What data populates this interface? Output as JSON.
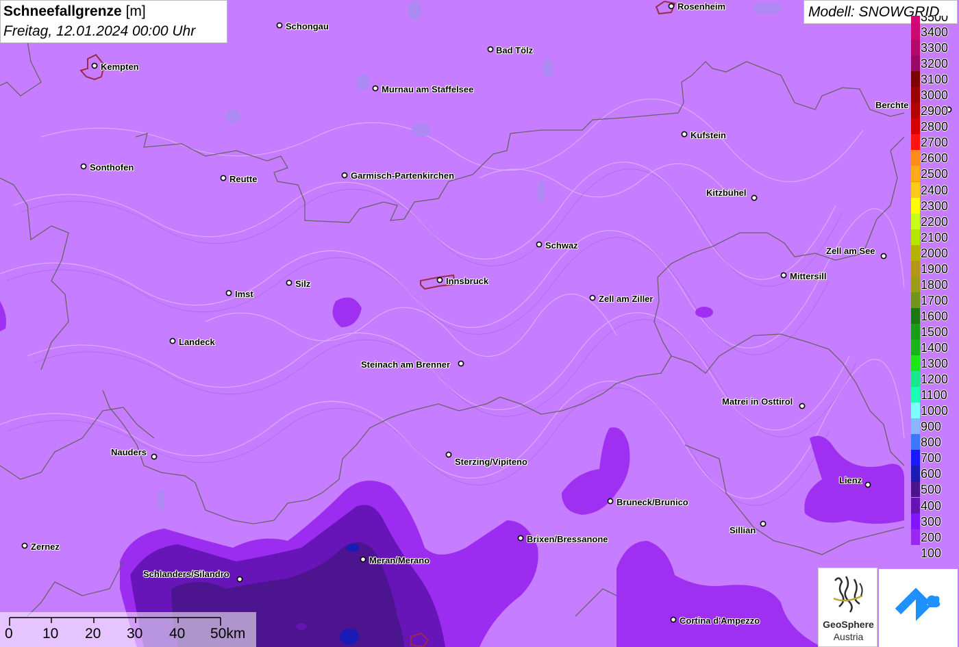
{
  "header": {
    "title": "Schneefallgrenze",
    "unit": "[m]",
    "datetime": "Freitag, 12.01.2024 00:00 Uhr",
    "model": "Modell: SNOWGRID"
  },
  "legend": {
    "partial_top": "3500",
    "items": [
      {
        "label": "3400",
        "color": "#cc0a6e"
      },
      {
        "label": "3300",
        "color": "#b30a6a"
      },
      {
        "label": "3200",
        "color": "#990a66"
      },
      {
        "label": "3100",
        "color": "#7f0000"
      },
      {
        "label": "3000",
        "color": "#990000"
      },
      {
        "label": "2900",
        "color": "#b30000"
      },
      {
        "label": "2800",
        "color": "#d40000"
      },
      {
        "label": "2700",
        "color": "#ff1414"
      },
      {
        "label": "2600",
        "color": "#ff8c1a"
      },
      {
        "label": "2500",
        "color": "#ffaa1a"
      },
      {
        "label": "2400",
        "color": "#ffc81a"
      },
      {
        "label": "2300",
        "color": "#ffff00"
      },
      {
        "label": "2200",
        "color": "#c8ff1a"
      },
      {
        "label": "2100",
        "color": "#b4e600"
      },
      {
        "label": "2000",
        "color": "#b4b400"
      },
      {
        "label": "1900",
        "color": "#b4961a"
      },
      {
        "label": "1800",
        "color": "#9b9b1a"
      },
      {
        "label": "1700",
        "color": "#6e961a"
      },
      {
        "label": "1600",
        "color": "#1a7814"
      },
      {
        "label": "1500",
        "color": "#1a9b1a"
      },
      {
        "label": "1400",
        "color": "#1ab41a"
      },
      {
        "label": "1300",
        "color": "#1ae61a"
      },
      {
        "label": "1200",
        "color": "#1ae68c"
      },
      {
        "label": "1100",
        "color": "#1affb4"
      },
      {
        "label": "1000",
        "color": "#7fffff"
      },
      {
        "label": "900",
        "color": "#8cb4ff"
      },
      {
        "label": "800",
        "color": "#3c78ff"
      },
      {
        "label": "700",
        "color": "#1a1aff"
      },
      {
        "label": "600",
        "color": "#1a1ab4"
      },
      {
        "label": "500",
        "color": "#4b148c"
      },
      {
        "label": "400",
        "color": "#6414b4"
      },
      {
        "label": "300",
        "color": "#8214ff"
      },
      {
        "label": "200",
        "color": "#9b28f0"
      },
      {
        "label": "100",
        "color": "#c77dff"
      }
    ]
  },
  "cities": [
    {
      "name": "Rosenheim"
    },
    {
      "name": "Schongau"
    },
    {
      "name": "Kempten"
    },
    {
      "name": "Bad Tölz"
    },
    {
      "name": "Murnau am Staffelsee"
    },
    {
      "name": "Berchte"
    },
    {
      "name": "Kufstein"
    },
    {
      "name": "Sonthofen"
    },
    {
      "name": "Reutte"
    },
    {
      "name": "Garmisch-Partenkirchen"
    },
    {
      "name": "Kitzbühel"
    },
    {
      "name": "Schwaz"
    },
    {
      "name": "Zell am See"
    },
    {
      "name": "Mittersill"
    },
    {
      "name": "Silz"
    },
    {
      "name": "Innsbruck"
    },
    {
      "name": "Imst"
    },
    {
      "name": "Zell am Ziller"
    },
    {
      "name": "Landeck"
    },
    {
      "name": "Steinach am Brenner"
    },
    {
      "name": "Matrei in Osttirol"
    },
    {
      "name": "Nauders"
    },
    {
      "name": "Sterzing/Vipiteno"
    },
    {
      "name": "Lienz"
    },
    {
      "name": "Bruneck/Brunico"
    },
    {
      "name": "Sillian"
    },
    {
      "name": "Brixen/Bressanone"
    },
    {
      "name": "Zernez"
    },
    {
      "name": "Meran/Merano"
    },
    {
      "name": "Schlanders/Silandro"
    },
    {
      "name": "Cortina d'Ampezzo"
    }
  ],
  "scale": {
    "labels": [
      "0",
      "10",
      "20",
      "30",
      "40",
      "50km"
    ]
  },
  "logos": {
    "geosphere_line1": "GeoSphere",
    "geosphere_line2": "Austria",
    "snowgrid_icon": "cloud-chevron-icon"
  }
}
